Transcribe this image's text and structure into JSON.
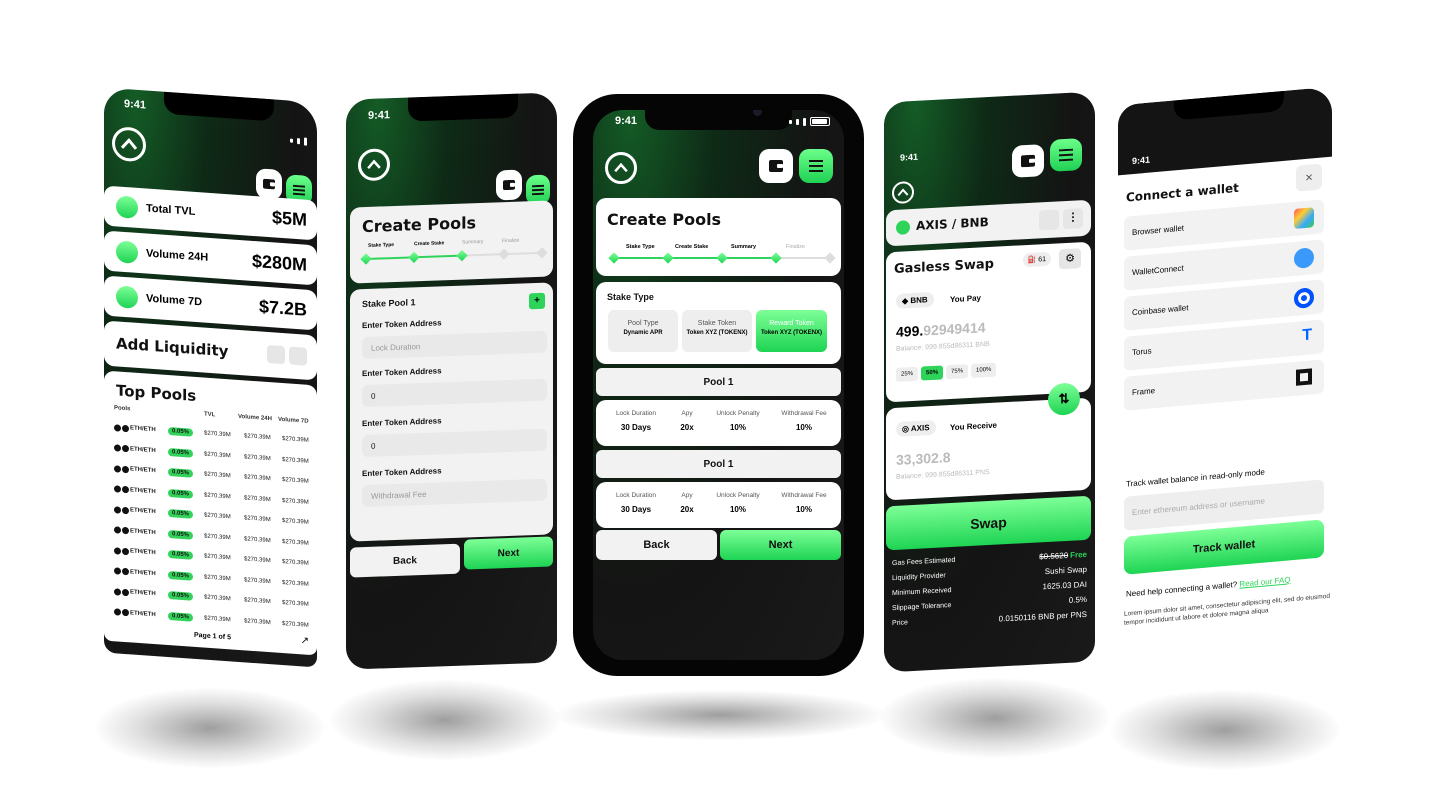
{
  "status_time": "9:41",
  "phone1": {
    "stats": [
      {
        "label": "Total TVL",
        "value": "$5M"
      },
      {
        "label": "Volume 24H",
        "value": "$280M"
      },
      {
        "label": "Volume 7D",
        "value": "$7.2B"
      }
    ],
    "add_liquidity": "Add Liquidity",
    "top_pools": "Top Pools",
    "columns": [
      "Pools",
      "TVL",
      "Volume 24H",
      "Volume 7D"
    ],
    "rows": [
      {
        "pair": "ETH/ETH",
        "fee": "0.05%",
        "tvl": "$270.39M",
        "v24": "$270.39M",
        "v7": "$270.39M"
      },
      {
        "pair": "ETH/ETH",
        "fee": "0.05%",
        "tvl": "$270.39M",
        "v24": "$270.39M",
        "v7": "$270.39M"
      },
      {
        "pair": "ETH/ETH",
        "fee": "0.05%",
        "tvl": "$270.39M",
        "v24": "$270.39M",
        "v7": "$270.39M"
      },
      {
        "pair": "ETH/ETH",
        "fee": "0.05%",
        "tvl": "$270.39M",
        "v24": "$270.39M",
        "v7": "$270.39M"
      },
      {
        "pair": "ETH/ETH",
        "fee": "0.05%",
        "tvl": "$270.39M",
        "v24": "$270.39M",
        "v7": "$270.39M"
      },
      {
        "pair": "ETH/ETH",
        "fee": "0.05%",
        "tvl": "$270.39M",
        "v24": "$270.39M",
        "v7": "$270.39M"
      },
      {
        "pair": "ETH/ETH",
        "fee": "0.05%",
        "tvl": "$270.39M",
        "v24": "$270.39M",
        "v7": "$270.39M"
      },
      {
        "pair": "ETH/ETH",
        "fee": "0.05%",
        "tvl": "$270.39M",
        "v24": "$270.39M",
        "v7": "$270.39M"
      },
      {
        "pair": "ETH/ETH",
        "fee": "0.05%",
        "tvl": "$270.39M",
        "v24": "$270.39M",
        "v7": "$270.39M"
      },
      {
        "pair": "ETH/ETH",
        "fee": "0.05%",
        "tvl": "$270.39M",
        "v24": "$270.39M",
        "v7": "$270.39M"
      }
    ],
    "pagination": "Page 1 of 5"
  },
  "phone2": {
    "title": "Create Pools",
    "steps": [
      "Stake Type",
      "Create Stake",
      "Summary",
      "Finalize"
    ],
    "pool_title": "Stake Pool 1",
    "fields": [
      {
        "label": "Enter Token Address",
        "value": "",
        "placeholder": "Lock Duration"
      },
      {
        "label": "Enter Token Address",
        "value": "0",
        "placeholder": ""
      },
      {
        "label": "Enter Token Address",
        "value": "0",
        "placeholder": ""
      },
      {
        "label": "Enter Token Address",
        "value": "",
        "placeholder": "Withdrawal Fee"
      }
    ],
    "back": "Back",
    "next": "Next"
  },
  "phone3": {
    "title": "Create Pools",
    "steps": [
      "Stake Type",
      "Create Stake",
      "Summary",
      "Finalize"
    ],
    "stake_type_title": "Stake Type",
    "options": [
      {
        "label": "Pool Type",
        "value": "Dynamic APR",
        "selected": false
      },
      {
        "label": "Stake Token",
        "value": "Token XYZ (TOKENX)",
        "selected": false
      },
      {
        "label": "Reward Token",
        "value": "Token XYZ (TOKENX)",
        "selected": true
      }
    ],
    "pools": [
      {
        "name": "Pool 1",
        "headers": [
          "Lock Duration",
          "Apy",
          "Unlock Penalty",
          "Withdrawal Fee"
        ],
        "values": [
          "30 Days",
          "20x",
          "10%",
          "10%"
        ]
      },
      {
        "name": "Pool 1",
        "headers": [
          "Lock Duration",
          "Apy",
          "Unlock Penalty",
          "Withdrawal Fee"
        ],
        "values": [
          "30 Days",
          "20x",
          "10%",
          "10%"
        ]
      }
    ],
    "back": "Back",
    "next": "Next"
  },
  "phone4": {
    "pair": "AXIS / BNB",
    "title": "Gasless Swap",
    "gas_count": "61",
    "pay_token": "BNB",
    "pay_label": "You Pay",
    "pay_amount_main": "499.",
    "pay_amount_dec": "92949414",
    "pay_balance": "Balance: 999.855d86311 BNB",
    "percents": [
      "25%",
      "50%",
      "75%",
      "100%"
    ],
    "receive_token": "AXIS",
    "receive_label": "You Receive",
    "receive_amount": "33,302.8",
    "receive_balance": "Balance: 999.855d86311 PNS",
    "swap": "Swap",
    "details": [
      {
        "label": "Gas Fees Estimated",
        "value": "$0.5620",
        "extra": "Free"
      },
      {
        "label": "Liquidity Provider",
        "value": "Sushi Swap"
      },
      {
        "label": "Minimum Received",
        "value": "1625.03 DAI"
      },
      {
        "label": "Slippage Tolerance",
        "value": "0.5%"
      },
      {
        "label": "Price",
        "value": "0.0150116 BNB per PNS"
      }
    ]
  },
  "phone5": {
    "title": "Connect a wallet",
    "close": "×",
    "wallets": [
      "Browser wallet",
      "WalletConnect",
      "Coinbase wallet",
      "Torus",
      "Frame"
    ],
    "track_label": "Track wallet balance in read-only mode",
    "track_placeholder": "Enter ethereum address or username",
    "track_button": "Track wallet",
    "help_text": "Need help connecting a wallet?",
    "help_link": "Read our FAQ",
    "lorem": "Lorem ipsum dolor sit amet, consectetur adipiscing elit, sed do eiusmod tempor incididunt ut labore et dolore magna aliqua"
  },
  "colors": {
    "accent": "#2ed45a",
    "dark": "#141414",
    "card": "#f2f2f2"
  }
}
